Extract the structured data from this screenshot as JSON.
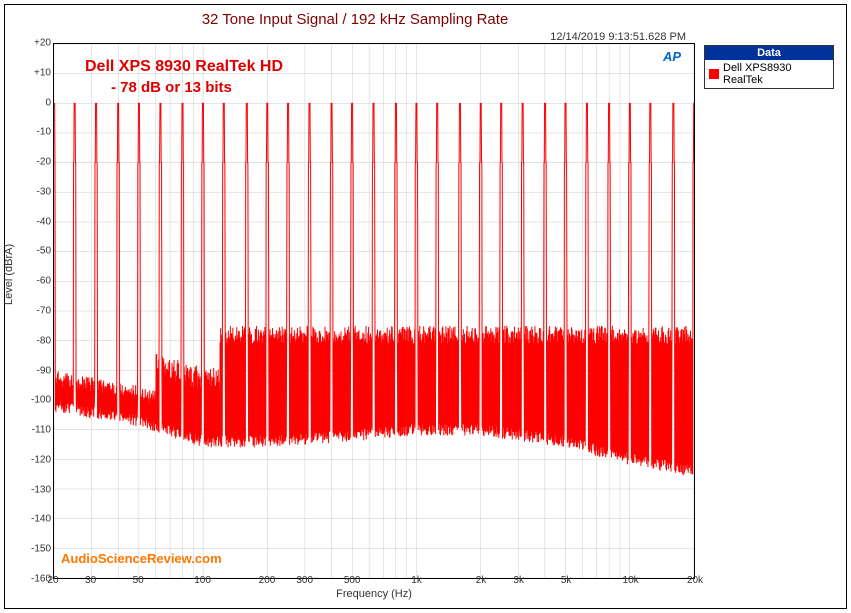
{
  "title": "32 Tone Input Signal / 192 kHz Sampling Rate",
  "timestamp": "12/14/2019 9:13:51.628 PM",
  "legend": {
    "header": "Data",
    "item_label": "Dell XPS8930 RealTek",
    "item_color": "#ff0000"
  },
  "annotation_line1": "Dell XPS 8930 RealTek HD",
  "annotation_line2": "- 78 dB or 13 bits",
  "watermark": "AudioScienceReview.com",
  "logo_text": "AP",
  "ylabel": "Level (dBrA)",
  "xlabel": "Frequency (Hz)",
  "chart_data": {
    "type": "line",
    "x_scale": "log",
    "x_range_hz": [
      20,
      20000
    ],
    "y_range_db": [
      -160,
      20
    ],
    "y_ticks": [
      20,
      10,
      0,
      -10,
      -20,
      -30,
      -40,
      -50,
      -60,
      -70,
      -80,
      -90,
      -100,
      -110,
      -120,
      -130,
      -140,
      -150,
      -160
    ],
    "x_ticks": [
      20,
      30,
      50,
      100,
      200,
      300,
      500,
      1000,
      2000,
      3000,
      5000,
      10000,
      20000
    ],
    "x_tick_labels": [
      "20",
      "30",
      "50",
      "100",
      "200",
      "300",
      "500",
      "1k",
      "2k",
      "3k",
      "5k",
      "10k",
      "20k"
    ],
    "series": [
      {
        "name": "Dell XPS8930 RealTek",
        "color": "#ff0000",
        "tone_peaks_hz": [
          20,
          25,
          31.5,
          40,
          50,
          63,
          80,
          100,
          125,
          160,
          200,
          250,
          315,
          400,
          500,
          630,
          800,
          1000,
          1250,
          1600,
          2000,
          2500,
          3150,
          4000,
          5000,
          6300,
          8000,
          10000,
          12500,
          16000,
          20000
        ],
        "tone_peak_level_db": 0,
        "noise_floor_db_by_band": [
          {
            "hz": 20,
            "floor_db": -100
          },
          {
            "hz": 50,
            "floor_db": -105
          },
          {
            "hz": 100,
            "floor_db": -112
          },
          {
            "hz": 200,
            "floor_db": -112
          },
          {
            "hz": 500,
            "floor_db": -110
          },
          {
            "hz": 1000,
            "floor_db": -108
          },
          {
            "hz": 2000,
            "floor_db": -108
          },
          {
            "hz": 5000,
            "floor_db": -112
          },
          {
            "hz": 10000,
            "floor_db": -118
          },
          {
            "hz": 20000,
            "floor_db": -122
          }
        ],
        "distortion_grass_top_db": -78,
        "summary": "Multitone spectrum: 32 principal tones at 0 dBrA; intermodulation/distortion 'grass' rising to about -78 dB (≈13-bit equivalent) above ~150 Hz; noise floor ~ -100 to -122 dB, sloping down with frequency."
      }
    ]
  }
}
